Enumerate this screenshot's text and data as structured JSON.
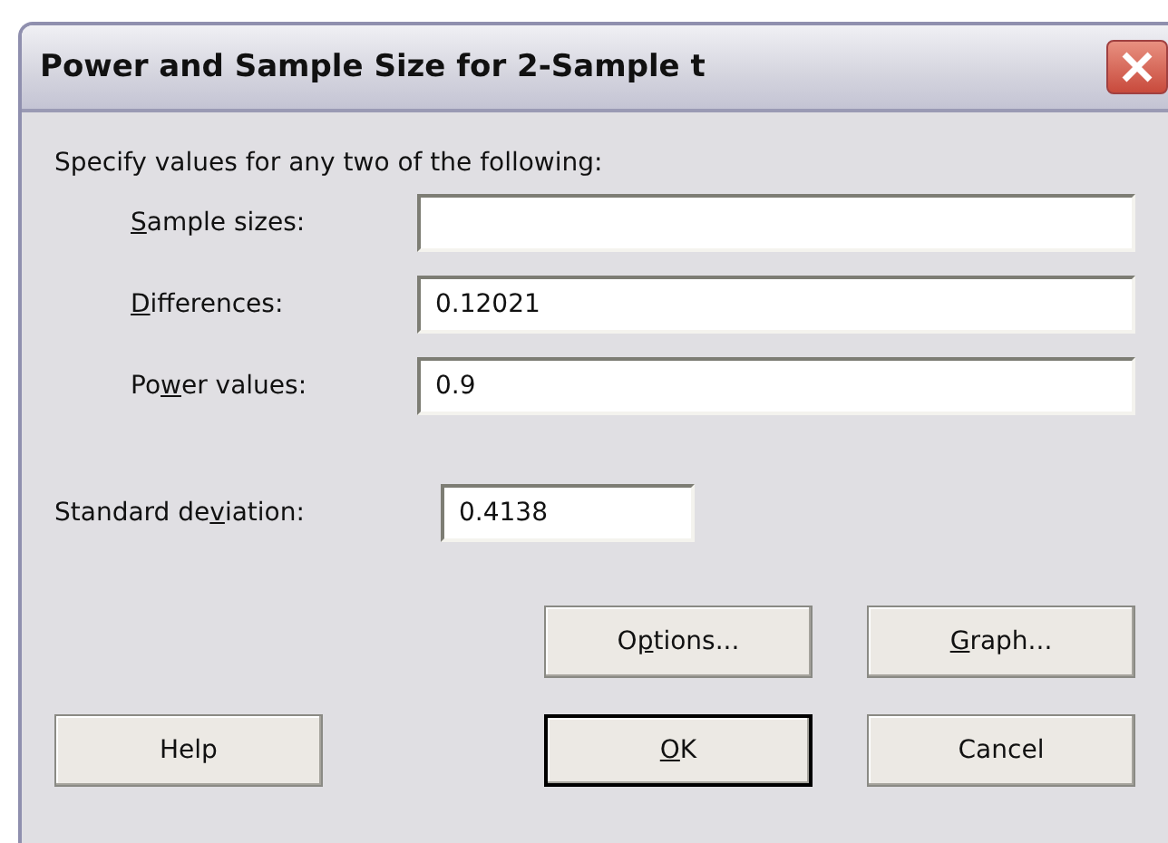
{
  "window": {
    "title": "Power and Sample Size for 2-Sample t"
  },
  "instruction": "Specify values for any two of the following:",
  "fields": [
    {
      "label": {
        "key": "S",
        "post": "ample sizes:"
      }
    },
    {
      "label": {
        "key": "D",
        "post": "ifferences:"
      },
      "value": "0.12021"
    },
    {
      "label": {
        "pre": "Po",
        "key": "w",
        "post": "er values:"
      },
      "value": "0.9"
    }
  ],
  "std_dev": {
    "label": {
      "pre": "Standard de",
      "key": "v",
      "post": "iation:"
    },
    "value": "0.4138"
  },
  "buttons": [
    {
      "label": {
        "pre": "O",
        "key": "p",
        "post": "tions..."
      },
      "default": false
    },
    {
      "label": {
        "key": "G",
        "post": "raph..."
      },
      "default": false
    },
    {
      "label": {
        "pre": "Help"
      },
      "default": false
    },
    {
      "label": {
        "key": "O",
        "post": "K"
      },
      "default": true
    },
    {
      "label": {
        "pre": "Cancel"
      },
      "default": false
    }
  ]
}
